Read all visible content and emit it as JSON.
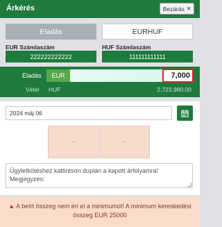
{
  "window": {
    "title": "Árkérés",
    "close_label": "Bezárás",
    "close_icon": "close-icon"
  },
  "mode": {
    "sell_label": "Eladás",
    "pair_label": "EURHUF"
  },
  "accounts": {
    "eur_label": "EUR Számlaszám",
    "eur_number": "222222222222",
    "huf_label": "HUF Számlaszám",
    "huf_number": "111111111111"
  },
  "trade": {
    "sell_label": "Eladás",
    "sell_currency": "EUR",
    "amount": "7,000",
    "buy_label": "Vétel",
    "buy_currency": "HUF",
    "buy_amount": "2,723,980.00"
  },
  "date": {
    "value": "2024 máj 06",
    "calendar_icon": "calendar-icon"
  },
  "rate_slots": [
    "–",
    "–"
  ],
  "note": {
    "placeholder": "Ügyletkötéshez kattintson duplán a kapott árfolyamra! Megjegyzés:"
  },
  "warning": {
    "icon": "▲",
    "text": "A beírt összeg nem éri el a minimumot! A minimum kereskedési összeg EUR 25000"
  },
  "colors": {
    "primary": "#1f7a3e",
    "accent_green": "#57a84a",
    "error_red": "#d9242a",
    "warning_bg": "#fbdccb"
  }
}
